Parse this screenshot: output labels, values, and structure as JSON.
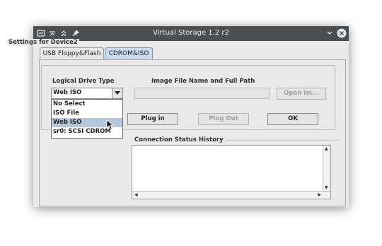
{
  "window": {
    "title": "Virtual Storage 1.2 r2",
    "titlebar_icons": [
      "app-icon",
      "keep-above-icon",
      "keep-below-icon",
      "pin-icon"
    ],
    "controls": [
      "minimize-chevron-icon",
      "close-icon"
    ]
  },
  "tabs": [
    {
      "label": "USB Floppy&Flash",
      "active": false
    },
    {
      "label": "CDROM&ISO",
      "active": true
    }
  ],
  "settings": {
    "group_title": "Settings for Device2",
    "drive_type_label": "Logical Drive Type",
    "image_label": "Image File Name and Full Path",
    "drive_type_value": "Web ISO",
    "image_path_value": "",
    "open_image_label": "Open Im..."
  },
  "dropdown": {
    "options": [
      "No Select",
      "ISO File",
      "Web ISO",
      "sr0: SCSI CDROM"
    ],
    "selected": "Web ISO"
  },
  "buttons": {
    "plug_in": "Plug in",
    "plug_out": "Plug Out",
    "ok": "OK"
  },
  "status": {
    "title": "Connection Status History",
    "content": ""
  },
  "colors": {
    "titlebar": "#4c4f52",
    "tab_active": "#c9dbee",
    "selection": "#b6c6db"
  }
}
